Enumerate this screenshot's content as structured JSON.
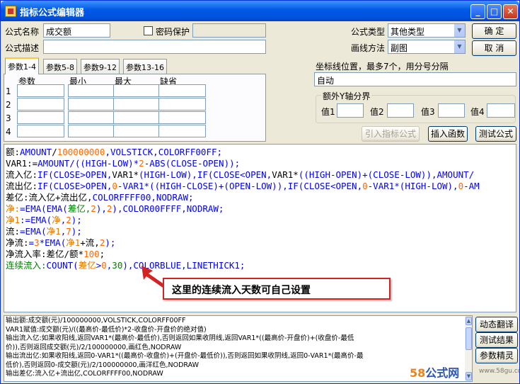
{
  "window": {
    "title": "指标公式编辑器"
  },
  "form": {
    "name_label": "公式名称",
    "name_value": "成交额",
    "password_label": "密码保护",
    "desc_label": "公式描述",
    "desc_value": "",
    "type_label": "公式类型",
    "type_value": "其他类型",
    "draw_label": "画线方法",
    "draw_value": "副图",
    "ok": "确  定",
    "cancel": "取  消"
  },
  "params": {
    "tabs": [
      "参数1-4",
      "参数5-8",
      "参数9-12",
      "参数13-16"
    ],
    "headers": [
      "参数",
      "最小",
      "最大",
      "缺省"
    ],
    "rows": [
      "1",
      "2",
      "3",
      "4"
    ]
  },
  "axis": {
    "label": "坐标线位置，最多7个，用分号分隔",
    "value": "自动",
    "group_label": "额外Y轴分界",
    "vals": [
      "值1",
      "值2",
      "值3",
      "值4"
    ]
  },
  "actions": {
    "import": "引入指标公式",
    "insert": "插入函数",
    "test": "测试公式"
  },
  "code": [
    {
      "parts": [
        {
          "t": "额:",
          "c": ""
        },
        {
          "t": "AMOUNT",
          "c": "k"
        },
        {
          "t": "/",
          "c": ""
        },
        {
          "t": "100000000",
          "c": "n"
        },
        {
          "t": ",VOLSTICK,COLORFF00FF;",
          "c": "k"
        }
      ]
    },
    {
      "parts": [
        {
          "t": "VAR1:=",
          "c": ""
        },
        {
          "t": "AMOUNT/((HIGH-LOW)*",
          "c": "k"
        },
        {
          "t": "2",
          "c": "n"
        },
        {
          "t": "-ABS(CLOSE-OPEN));",
          "c": "k"
        }
      ]
    },
    {
      "parts": [
        {
          "t": "流入亿:",
          "c": ""
        },
        {
          "t": "IF(CLOSE>OPEN,",
          "c": "k"
        },
        {
          "t": "VAR1*",
          "c": ""
        },
        {
          "t": "(HIGH-LOW),IF(CLOSE<OPEN,",
          "c": "k"
        },
        {
          "t": "VAR1*",
          "c": ""
        },
        {
          "t": "((HIGH-OPEN)+(CLOSE-LOW)),AMOUNT/",
          "c": "k"
        }
      ]
    },
    {
      "parts": [
        {
          "t": "流出亿:",
          "c": ""
        },
        {
          "t": "IF(CLOSE>OPEN,",
          "c": "k"
        },
        {
          "t": "0",
          "c": "n"
        },
        {
          "t": "-VAR1*",
          "c": "k"
        },
        {
          "t": "((HIGH-CLOSE)+(OPEN-LOW)),IF(CLOSE<OPEN,",
          "c": "k"
        },
        {
          "t": "0",
          "c": "n"
        },
        {
          "t": "-VAR1*(HIGH-LOW),",
          "c": "k"
        },
        {
          "t": "0",
          "c": "n"
        },
        {
          "t": "-AM",
          "c": "k"
        }
      ]
    },
    {
      "parts": [
        {
          "t": "差亿:流入亿+流出亿,",
          "c": ""
        },
        {
          "t": "COLORFFFF00,NODRAW;",
          "c": "k"
        }
      ]
    },
    {
      "parts": [
        {
          "t": "净:",
          "c": "o"
        },
        {
          "t": "=EMA(EMA(",
          "c": "k"
        },
        {
          "t": "差亿,",
          "c": "g"
        },
        {
          "t": "2",
          "c": "n"
        },
        {
          "t": "),",
          "c": "k"
        },
        {
          "t": "2",
          "c": "n"
        },
        {
          "t": "),COLOR00FFFF,NODRAW;",
          "c": "k"
        }
      ]
    },
    {
      "parts": [
        {
          "t": "净1",
          "c": "o"
        },
        {
          "t": ":=EMA(",
          "c": "k"
        },
        {
          "t": "净",
          "c": "o"
        },
        {
          "t": ",",
          "c": "k"
        },
        {
          "t": "2",
          "c": "n"
        },
        {
          "t": ");",
          "c": "k"
        }
      ]
    },
    {
      "parts": [
        {
          "t": "流:",
          "c": ""
        },
        {
          "t": "=EMA(",
          "c": "k"
        },
        {
          "t": "净1",
          "c": "o"
        },
        {
          "t": ",",
          "c": "k"
        },
        {
          "t": "7",
          "c": "n"
        },
        {
          "t": ");",
          "c": "k"
        }
      ]
    },
    {
      "parts": [
        {
          "t": "净流:",
          "c": ""
        },
        {
          "t": "=",
          "c": "k"
        },
        {
          "t": "3",
          "c": "n"
        },
        {
          "t": "*EMA(",
          "c": "k"
        },
        {
          "t": "净1",
          "c": "o"
        },
        {
          "t": "+流,",
          "c": ""
        },
        {
          "t": "2",
          "c": "n"
        },
        {
          "t": ");",
          "c": "k"
        }
      ]
    },
    {
      "parts": [
        {
          "t": "净流入率:差亿/额*",
          "c": ""
        },
        {
          "t": "100",
          "c": "n"
        },
        {
          "t": ";",
          "c": ""
        }
      ]
    },
    {
      "parts": [
        {
          "t": "连续流入:",
          "c": "g"
        },
        {
          "t": "COUNT(",
          "c": "k"
        },
        {
          "t": "差亿",
          "c": "o"
        },
        {
          "t": ">",
          "c": "k"
        },
        {
          "t": "0",
          "c": "n"
        },
        {
          "t": ",",
          "c": "k"
        },
        {
          "t": "30",
          "c": "g"
        },
        {
          "t": "),COLORBLUE,LINETHICK1;",
          "c": "k"
        }
      ]
    }
  ],
  "callout": "这里的连续流入天数可自己设置",
  "output": [
    "输出额:成交额(元)/100000000,VOLSTICK,COLORFF00FF",
    "VAR1赋值:成交额(元)/((最高价-最低价)*2-收盘价-开盘价的绝对值)",
    "输出流入亿:如果收阳线,返回VAR1*(最高价-最低价),否则返回如果收阴线,返回VAR1*((最高价-开盘价)+(收盘价-最低",
    "价)),否则返回成交额(元)/2/100000000,画红色,NODRAW",
    "输出流出亿:如果收阳线,返回0-VAR1*((最高价-收盘价)+(开盘价-最低价)),否则返回如果收阴线,返回0-VAR1*(最高价-最",
    "低价),否则返回0-成交额(元)/2/100000000,画洋红色,NODRAW",
    "输出差亿:流入亿+流出亿,COLORFFFF00,NODRAW"
  ],
  "side": {
    "translate": "动态翻译",
    "test_result": "测试结果",
    "param_help": "参数精灵"
  },
  "watermark": {
    "brand_num": "58",
    "brand_text": "公式网",
    "url": "www.58gu.com"
  }
}
